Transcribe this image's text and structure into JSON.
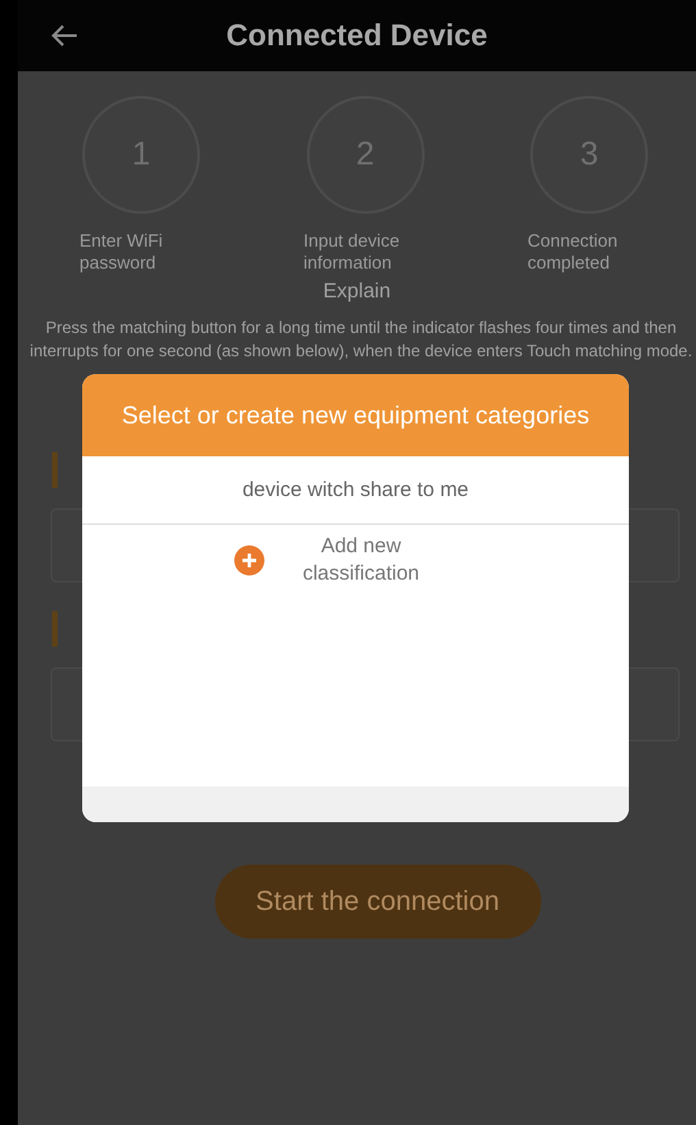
{
  "header": {
    "title": "Connected Device"
  },
  "steps": [
    {
      "number": "1",
      "label": "Enter WiFi password"
    },
    {
      "number": "2",
      "label": "Input device information"
    },
    {
      "number": "3",
      "label": "Connection completed"
    }
  ],
  "explain": {
    "title": "Explain",
    "text": "Press the matching button for a long time until the indicator flashes four times and then interrupts for one second (as shown below), when the device enters Touch matching mode."
  },
  "connect_button": "Start the connection",
  "dialog": {
    "title": "Select or create new equipment categories",
    "items": [
      {
        "kind": "category",
        "label": "device witch share to me"
      },
      {
        "kind": "add",
        "label": "Add new classification"
      }
    ]
  }
}
